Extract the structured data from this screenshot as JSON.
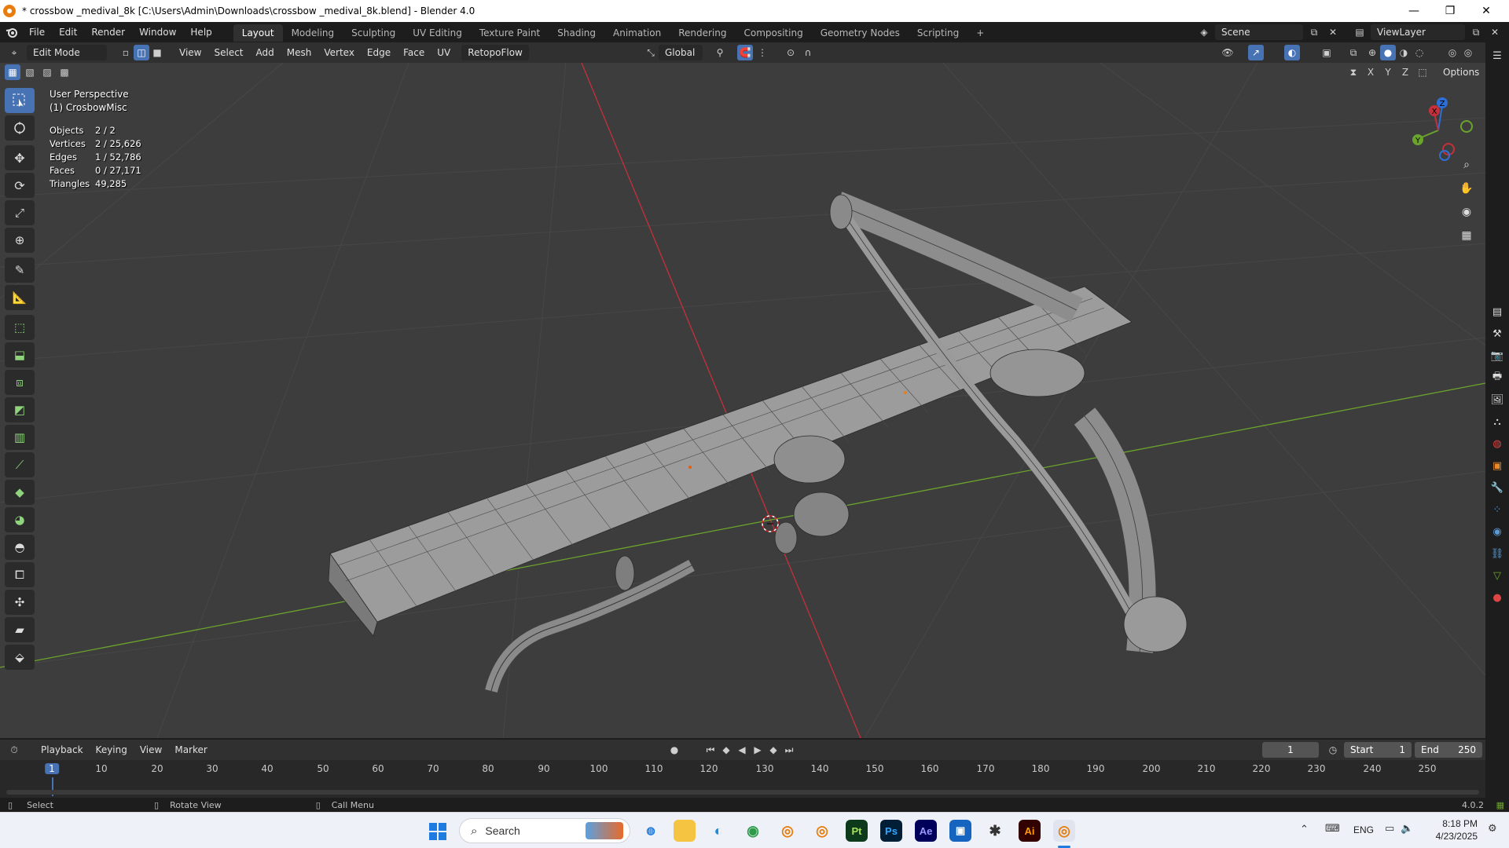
{
  "window": {
    "title": "* crossbow _medival_8k [C:\\Users\\Admin\\Downloads\\crossbow _medival_8k.blend] - Blender 4.0",
    "minimize": "—",
    "maximize": "❐",
    "close": "✕"
  },
  "menu": {
    "items": [
      "File",
      "Edit",
      "Render",
      "Window",
      "Help"
    ],
    "workspaces": [
      "Layout",
      "Modeling",
      "Sculpting",
      "UV Editing",
      "Texture Paint",
      "Shading",
      "Animation",
      "Rendering",
      "Compositing",
      "Geometry Nodes",
      "Scripting"
    ],
    "active_workspace": "Layout",
    "add_workspace": "+",
    "scene": "Scene",
    "view_layer": "ViewLayer"
  },
  "viewport_header": {
    "mode": "Edit Mode",
    "menus": [
      "View",
      "Select",
      "Add",
      "Mesh",
      "Vertex",
      "Edge",
      "Face",
      "UV"
    ],
    "addon": "RetopoFlow",
    "orientation": "Global",
    "options": "Options",
    "axes": [
      "X",
      "Y",
      "Z"
    ]
  },
  "overlay": {
    "perspective": "User Perspective",
    "object": "(1) CrosbowMisc"
  },
  "stats": [
    {
      "label": "Objects",
      "value": "2 / 2"
    },
    {
      "label": "Vertices",
      "value": "2 / 25,626"
    },
    {
      "label": "Edges",
      "value": "1 / 52,786"
    },
    {
      "label": "Faces",
      "value": "0 / 27,171"
    },
    {
      "label": "Triangles",
      "value": "49,285"
    }
  ],
  "gizmo": {
    "x": "X",
    "y": "Y",
    "z": "Z"
  },
  "timeline": {
    "menus": [
      "Playback",
      "Keying",
      "View",
      "Marker"
    ],
    "current_frame": "1",
    "start_label": "Start",
    "start": "1",
    "end_label": "End",
    "end": "250",
    "ticks": [
      "1",
      "10",
      "20",
      "30",
      "40",
      "50",
      "60",
      "70",
      "80",
      "90",
      "100",
      "110",
      "120",
      "130",
      "140",
      "150",
      "160",
      "170",
      "180",
      "190",
      "200",
      "210",
      "220",
      "230",
      "240",
      "250"
    ]
  },
  "statusbar": {
    "select": "Select",
    "rotate": "Rotate View",
    "menu": "Call Menu",
    "version": "4.0.2"
  },
  "taskbar": {
    "search": "Search",
    "lang": "ENG",
    "time": "8:18 PM",
    "date": "4/23/2025",
    "apps": [
      "Pt",
      "Ps",
      "Ae",
      "Ai"
    ]
  },
  "colors": {
    "accent": "#4772b3",
    "x_axis": "#c6303b",
    "y_axis": "#6ba42c",
    "viewport_bg": "#3d3d3d",
    "blender_orange": "#e87d0d"
  }
}
